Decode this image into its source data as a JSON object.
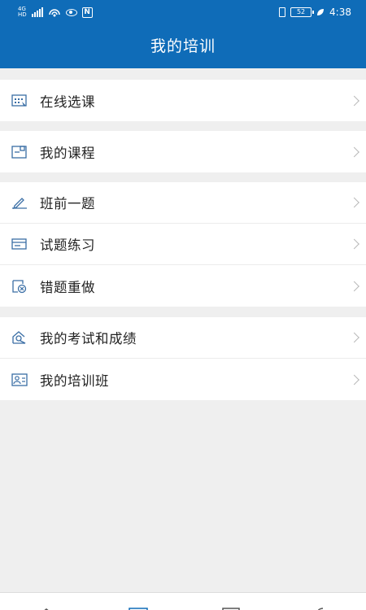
{
  "status_bar": {
    "network_top": "4G",
    "network_bottom": "HD",
    "battery": "52",
    "time": "4:38"
  },
  "header": {
    "title": "我的培训"
  },
  "menu": {
    "online_course": "在线选课",
    "my_courses": "我的课程",
    "question_before_class": "班前一题",
    "practice": "试题练习",
    "redo_wrong": "错题重做",
    "exams_scores": "我的考试和成绩",
    "my_training_class": "我的培训班"
  },
  "colors": {
    "primary": "#0f6cb8",
    "icon": "#3a6ea5",
    "background": "#efefef"
  },
  "icons": {
    "online_course": "course-grid-icon",
    "my_courses": "folder-icon",
    "question_before_class": "pencil-icon",
    "practice": "document-icon",
    "redo_wrong": "retry-icon",
    "exams_scores": "exam-icon",
    "my_training_class": "id-card-icon"
  }
}
